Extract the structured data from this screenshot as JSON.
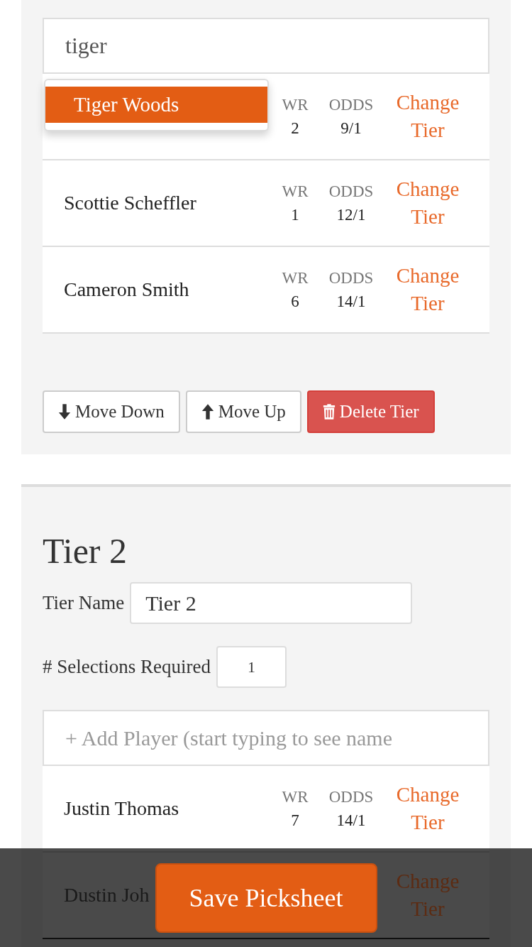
{
  "tier1": {
    "search": {
      "value": "tiger"
    },
    "suggestions": [
      {
        "label": "Tiger Woods",
        "selected": true
      }
    ],
    "players": [
      {
        "wr_label": "WR",
        "wr": "2",
        "odds_label": "ODDS",
        "odds": "9/1",
        "action": "Change Tier"
      },
      {
        "name": "Scottie Scheffler",
        "wr_label": "WR",
        "wr": "1",
        "odds_label": "ODDS",
        "odds": "12/1",
        "action": "Change Tier"
      },
      {
        "name": "Cameron Smith",
        "wr_label": "WR",
        "wr": "6",
        "odds_label": "ODDS",
        "odds": "14/1",
        "action": "Change Tier"
      }
    ],
    "buttons": [
      {
        "kind": "down",
        "label": "Move Down"
      },
      {
        "kind": "up",
        "label": "Move Up"
      },
      {
        "kind": "delete",
        "label": "Delete Tier"
      }
    ]
  },
  "tier2": {
    "title": "Tier 2",
    "name_label": "Tier Name",
    "name_value": "Tier 2",
    "selections_label": "# Selections Required",
    "selections_value": "1",
    "add_player": {
      "placeholder": "+ Add Player (start typing to see name"
    },
    "players": [
      {
        "name": "Justin Thomas",
        "wr_label": "WR",
        "wr": "7",
        "odds_label": "ODDS",
        "odds": "14/1",
        "action": "Change Tier"
      },
      {
        "name": "Dustin Joh",
        "action": "Change Tier"
      }
    ]
  },
  "save_button": "Save Picksheet"
}
